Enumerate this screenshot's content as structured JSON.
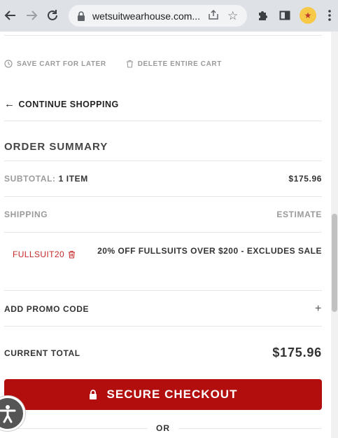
{
  "browser": {
    "url": "wetsuitwearhouse.com..."
  },
  "cart_actions": {
    "save_label": "SAVE CART FOR LATER",
    "delete_label": "DELETE ENTIRE CART"
  },
  "continue_label": "CONTINUE SHOPPING",
  "summary": {
    "title": "ORDER SUMMARY",
    "subtotal_label": "SUBTOTAL:",
    "subtotal_count": "1 ITEM",
    "subtotal_value": "$175.96",
    "shipping_label": "SHIPPING",
    "shipping_value": "ESTIMATE",
    "promo_code": "FULLSUIT20",
    "promo_description": "20% OFF FULLSUITS OVER $200 - EXCLUDES SALE",
    "add_promo_label": "ADD PROMO CODE",
    "add_promo_icon": "+",
    "total_label": "CURRENT TOTAL",
    "total_value": "$175.96"
  },
  "checkout_label": "SECURE CHECKOUT",
  "or_label": "OR",
  "colors": {
    "checkout_bg": "#b30e0e",
    "promo_code": "#c62828",
    "muted": "#9a9a9a"
  }
}
